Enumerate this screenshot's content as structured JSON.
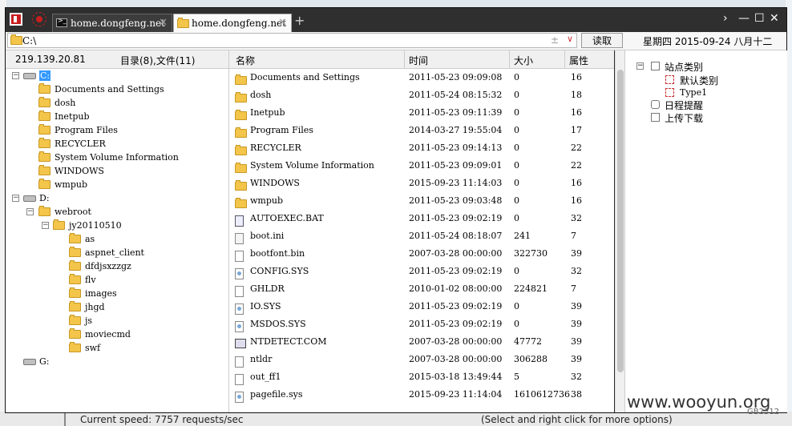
{
  "tabs": [
    {
      "label": "home.dongfeng.net",
      "active": false
    },
    {
      "label": "home.dongfeng.net",
      "active": true
    }
  ],
  "address": {
    "value": "C:\\",
    "pm": "±",
    "dropdown": "∨"
  },
  "read_button": "读取",
  "date": "星期四  2015-09-24  八月十二",
  "left_panel": {
    "ip": "219.139.20.81",
    "counts": "目录(8),文件(11)"
  },
  "tree": [
    {
      "label": "C:",
      "type": "drive",
      "level": 0,
      "expand": "−",
      "selected": true
    },
    {
      "label": "Documents and Settings",
      "type": "folder",
      "level": 1
    },
    {
      "label": "dosh",
      "type": "folder",
      "level": 1
    },
    {
      "label": "Inetpub",
      "type": "folder",
      "level": 1
    },
    {
      "label": "Program Files",
      "type": "folder",
      "level": 1
    },
    {
      "label": "RECYCLER",
      "type": "folder",
      "level": 1
    },
    {
      "label": "System Volume Information",
      "type": "folder",
      "level": 1
    },
    {
      "label": "WINDOWS",
      "type": "folder",
      "level": 1
    },
    {
      "label": "wmpub",
      "type": "folder",
      "level": 1
    },
    {
      "label": "D:",
      "type": "drive",
      "level": 0,
      "expand": "−"
    },
    {
      "label": "webroot",
      "type": "folder",
      "level": 1,
      "expand": "−"
    },
    {
      "label": "jy20110510",
      "type": "folder",
      "level": 2,
      "expand": "−"
    },
    {
      "label": "as",
      "type": "folder",
      "level": 3
    },
    {
      "label": "aspnet_client",
      "type": "folder",
      "level": 3
    },
    {
      "label": "dfdjsxzzgz",
      "type": "folder",
      "level": 3
    },
    {
      "label": "flv",
      "type": "folder",
      "level": 3
    },
    {
      "label": "images",
      "type": "folder",
      "level": 3
    },
    {
      "label": "jhgd",
      "type": "folder",
      "level": 3
    },
    {
      "label": "js",
      "type": "folder",
      "level": 3
    },
    {
      "label": "moviecmd",
      "type": "folder",
      "level": 3
    },
    {
      "label": "swf",
      "type": "folder",
      "level": 3
    },
    {
      "label": "G:",
      "type": "drive",
      "level": 0
    }
  ],
  "columns": {
    "name": "名称",
    "time": "时间",
    "size": "大小",
    "attr": "属性"
  },
  "files": [
    {
      "name": "Documents and Settings",
      "time": "2011-05-23 09:09:08",
      "size": "0",
      "attr": "16",
      "icon": "folder"
    },
    {
      "name": "dosh",
      "time": "2011-05-24 08:15:32",
      "size": "0",
      "attr": "18",
      "icon": "folder"
    },
    {
      "name": "Inetpub",
      "time": "2011-05-23 09:11:39",
      "size": "0",
      "attr": "16",
      "icon": "folder"
    },
    {
      "name": "Program Files",
      "time": "2014-03-27 19:55:04",
      "size": "0",
      "attr": "17",
      "icon": "folder"
    },
    {
      "name": "RECYCLER",
      "time": "2011-05-23 09:14:13",
      "size": "0",
      "attr": "22",
      "icon": "folder"
    },
    {
      "name": "System Volume Information",
      "time": "2011-05-23 09:09:01",
      "size": "0",
      "attr": "22",
      "icon": "folder"
    },
    {
      "name": "WINDOWS",
      "time": "2015-09-23 11:14:03",
      "size": "0",
      "attr": "16",
      "icon": "folder"
    },
    {
      "name": "wmpub",
      "time": "2011-05-23 09:03:48",
      "size": "0",
      "attr": "16",
      "icon": "folder"
    },
    {
      "name": "AUTOEXEC.BAT",
      "time": "2011-05-23 09:02:19",
      "size": "0",
      "attr": "32",
      "icon": "bat"
    },
    {
      "name": "boot.ini",
      "time": "2011-05-24 08:18:07",
      "size": "241",
      "attr": "7",
      "icon": "ini"
    },
    {
      "name": "bootfont.bin",
      "time": "2007-03-28 00:00:00",
      "size": "322730",
      "attr": "39",
      "icon": "file"
    },
    {
      "name": "CONFIG.SYS",
      "time": "2011-05-23 09:02:19",
      "size": "0",
      "attr": "32",
      "icon": "sys"
    },
    {
      "name": "GHLDR",
      "time": "2010-01-02 08:00:00",
      "size": "224821",
      "attr": "7",
      "icon": "file"
    },
    {
      "name": "IO.SYS",
      "time": "2011-05-23 09:02:19",
      "size": "0",
      "attr": "39",
      "icon": "sys"
    },
    {
      "name": "MSDOS.SYS",
      "time": "2011-05-23 09:02:19",
      "size": "0",
      "attr": "39",
      "icon": "sys"
    },
    {
      "name": "NTDETECT.COM",
      "time": "2007-03-28 00:00:00",
      "size": "47772",
      "attr": "39",
      "icon": "com"
    },
    {
      "name": "ntldr",
      "time": "2007-03-28 00:00:00",
      "size": "306288",
      "attr": "39",
      "icon": "file"
    },
    {
      "name": "out_ff1",
      "time": "2015-03-18 13:49:44",
      "size": "5",
      "attr": "32",
      "icon": "file"
    },
    {
      "name": "pagefile.sys",
      "time": "2015-09-23 11:14:04",
      "size": "1610612736",
      "attr": "38",
      "icon": "sys"
    }
  ],
  "right_tree": [
    {
      "label": "站点类别",
      "level": 0,
      "expand": "−",
      "icon": "box"
    },
    {
      "label": "默认类别",
      "level": 1,
      "icon": "red"
    },
    {
      "label": "Type1",
      "level": 1,
      "icon": "red",
      "small": true
    },
    {
      "label": "日程提醒",
      "level": 0,
      "icon": "clock"
    },
    {
      "label": "上传下载",
      "level": 0,
      "icon": "box"
    }
  ],
  "watermark": "www.wooyun.org",
  "watermark_small": "GB2312",
  "background_text": {
    "left": "Current speed: 7757 requests/sec",
    "right": "(Select and right click for more options)"
  }
}
